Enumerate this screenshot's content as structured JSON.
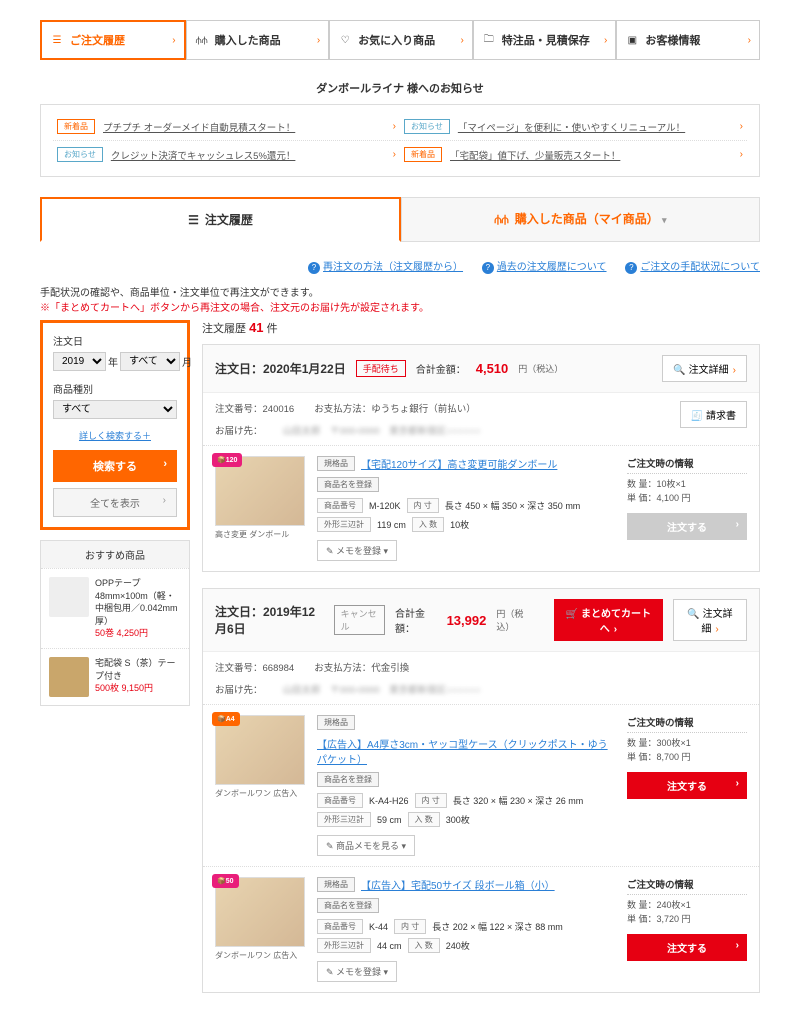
{
  "nav": [
    {
      "label": "ご注文履歴",
      "icon": "list-icon",
      "active": true
    },
    {
      "label": "購入した商品",
      "icon": "box-icon"
    },
    {
      "label": "お気に入り商品",
      "icon": "heart-icon"
    },
    {
      "label": "特注品・見積保存",
      "icon": "folder-icon"
    },
    {
      "label": "お客様情報",
      "icon": "person-icon"
    }
  ],
  "notice": {
    "title": "ダンボールライナ 様へのお知らせ",
    "items": [
      {
        "badge": "新着品",
        "badgeType": "new",
        "text": "プチプチ オーダーメイド自動見積スタート！"
      },
      {
        "badge": "お知らせ",
        "badgeType": "info",
        "text": "「マイページ」を便利に・使いやすくリニューアル！"
      },
      {
        "badge": "お知らせ",
        "badgeType": "info",
        "text": "クレジット決済でキャッシュレス5%還元！"
      },
      {
        "badge": "新着品",
        "badgeType": "new",
        "text": "「宅配袋」値下げ、少量販売スタート！"
      }
    ]
  },
  "sub_tabs": {
    "history": "注文履歴",
    "purchased": "購入した商品（マイ商品）"
  },
  "help": [
    "再注文の方法（注文履歴から）",
    "過去の注文履歴について",
    "ご注文の手配状況について"
  ],
  "intro": {
    "line1": "手配状況の確認や、商品単位・注文単位で再注文ができます。",
    "line2": "※「まとめてカートへ」ボタンから再注文の場合、注文元のお届け先が設定されます。"
  },
  "search": {
    "date_label": "注文日",
    "year_opt": "2019",
    "year_suffix": "年",
    "month_opt": "すべて",
    "month_suffix": "月",
    "type_label": "商品種別",
    "type_opt": "すべて",
    "detail_link": "詳しく検索する＋",
    "btn_search": "検索する",
    "btn_all": "全てを表示"
  },
  "recommend": {
    "title": "おすすめ商品",
    "items": [
      {
        "name": "OPPテープ 48mm×100m（軽・中梱包用／0.042mm厚）",
        "price": "50巻 4,250円"
      },
      {
        "name": "宅配袋 S（茶）テープ付き",
        "price": "500枚 9,150円"
      }
    ]
  },
  "result": {
    "label": "注文履歴",
    "count": "41",
    "unit": "件"
  },
  "orders": [
    {
      "date_lbl": "注文日：2020年1月22日",
      "status": "手配待ち",
      "status_type": "wait",
      "total_lbl": "合計金額：",
      "total_val": "4,510",
      "total_tax": "円（税込）",
      "order_no": "注文番号：240016",
      "pay": "お支払方法：ゆうちょ銀行（前払い）",
      "deliver": "お届け先：",
      "detail_btn": "注文詳細",
      "seikyusho": "請求書",
      "products": [
        {
          "badge": "120",
          "badge_color": "pink",
          "img_cap": "高さ変更 ダンボール",
          "tag": "規格品",
          "title": "【宅配120サイズ】高さ変更可能ダンボール",
          "name_reg": "商品名を登録",
          "code_lbl": "商品番号",
          "code": "M-120K",
          "size_lbl": "内 寸",
          "size": "長さ 450 × 幅 350 × 深さ 350 mm",
          "edge_lbl": "外形三辺計",
          "edge": "119 cm",
          "qty_lbl": "入 数",
          "qty": "10枚",
          "memo_btn": "メモを登録",
          "side_title": "ご注文時の情報",
          "side_qty": "数 量：10枚×1",
          "side_price": "単 価：4,100 円",
          "order_btn": "注文する",
          "order_btn_type": "gray"
        }
      ]
    },
    {
      "date_lbl": "注文日：2019年12月6日",
      "status": "キャンセル",
      "status_type": "cancel",
      "total_lbl": "合計金額：",
      "total_val": "13,992",
      "total_tax": "円（税込）",
      "order_no": "注文番号：668984",
      "pay": "お支払方法：代金引換",
      "deliver": "お届け先：",
      "detail_btn": "注文詳細",
      "cart_btn": "まとめてカートへ",
      "products": [
        {
          "badge": "A4",
          "badge_color": "orange",
          "img_cap": "ダンボールワン 広告入",
          "tag": "規格品",
          "title": "【広告入】A4厚さ3cm・ヤッコ型ケース（クリックポスト・ゆうパケット）",
          "name_reg": "商品名を登録",
          "code_lbl": "商品番号",
          "code": "K-A4-H26",
          "size_lbl": "内 寸",
          "size": "長さ 320 × 幅 230 × 深さ 26 mm",
          "edge_lbl": "外形三辺計",
          "edge": "59 cm",
          "qty_lbl": "入 数",
          "qty": "300枚",
          "memo_btn": "商品メモを見る",
          "side_title": "ご注文時の情報",
          "side_qty": "数 量：300枚×1",
          "side_price": "単 価：8,700 円",
          "order_btn": "注文する",
          "order_btn_type": "red"
        },
        {
          "badge": "50",
          "badge_color": "pink",
          "img_cap": "ダンボールワン 広告入",
          "tag": "規格品",
          "title": "【広告入】宅配50サイズ 段ボール箱（小）",
          "name_reg": "商品名を登録",
          "code_lbl": "商品番号",
          "code": "K-44",
          "size_lbl": "内 寸",
          "size": "長さ 202 × 幅 122 × 深さ 88 mm",
          "edge_lbl": "外形三辺計",
          "edge": "44 cm",
          "qty_lbl": "入 数",
          "qty": "240枚",
          "memo_btn": "メモを登録",
          "side_title": "ご注文時の情報",
          "side_qty": "数 量：240枚×1",
          "side_price": "単 価：3,720 円",
          "order_btn": "注文する",
          "order_btn_type": "red"
        }
      ]
    }
  ]
}
